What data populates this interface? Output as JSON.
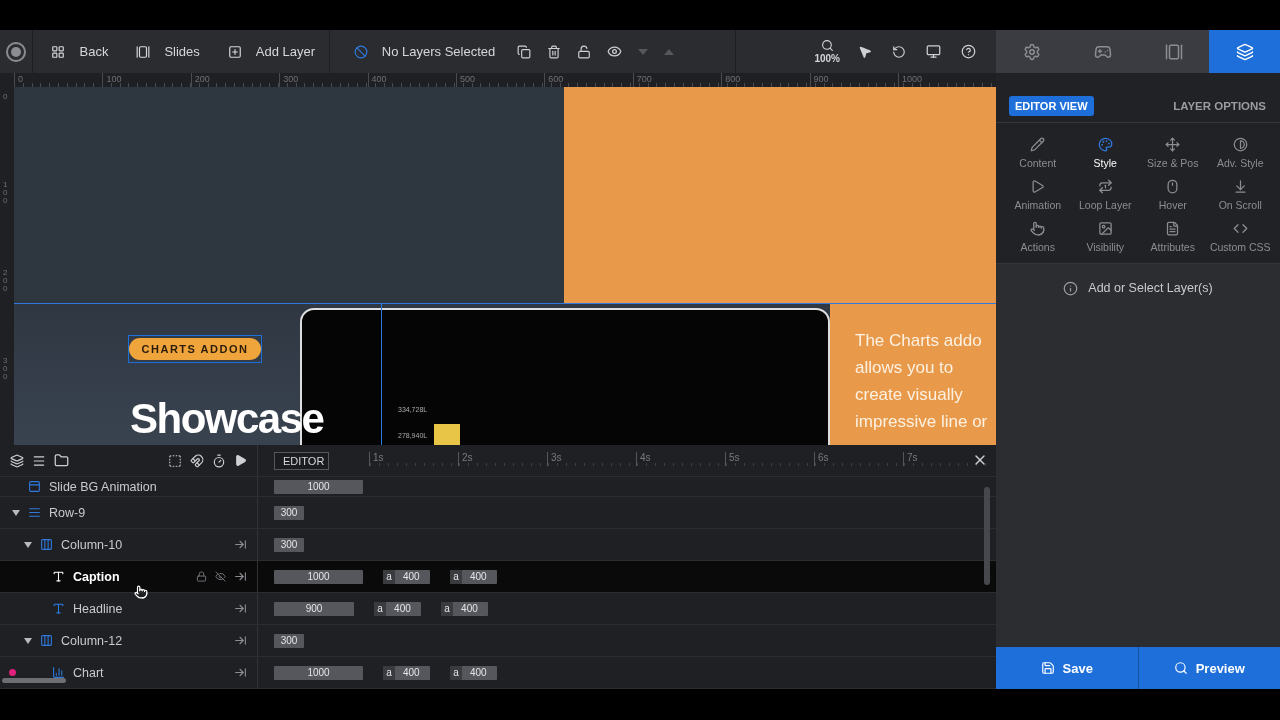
{
  "toolbar": {
    "items": [
      {
        "kind": "back",
        "label": "Back"
      },
      {
        "kind": "slides",
        "label": "Slides"
      },
      {
        "kind": "add",
        "label": "Add Layer"
      }
    ],
    "selection": "No Layers Selected",
    "zoom": "100%"
  },
  "ruler": {
    "marks": [
      "0",
      "100",
      "200",
      "300",
      "400",
      "500",
      "600",
      "700",
      "800",
      "900",
      "1000"
    ],
    "side_marks": [
      "0",
      "100",
      "200",
      "300"
    ]
  },
  "slide": {
    "badge": "CHARTS ADDON",
    "headline": "Showcase",
    "chart_labels": [
      "334,728L",
      "278,940L"
    ],
    "paragraph_lines": [
      "The Charts addo",
      "allows you to",
      "create visually",
      "impressive line or"
    ]
  },
  "timeline": {
    "mode": "EDITOR",
    "ticks": [
      "1s",
      "2s",
      "3s",
      "4s",
      "5s",
      "6s",
      "7s"
    ],
    "layers": [
      {
        "name": "Slide BG Animation",
        "kind": "background",
        "timing": [
          {
            "kind": "duration",
            "value": "1000"
          }
        ]
      },
      {
        "name": "Row-9",
        "kind": "row",
        "expanded": true,
        "timing": [
          {
            "kind": "duration",
            "value": "300"
          }
        ],
        "children": [
          {
            "name": "Column-10",
            "kind": "column",
            "expanded": true,
            "timing": [
              {
                "kind": "duration",
                "value": "300"
              }
            ],
            "children": [
              {
                "name": "Caption",
                "kind": "text",
                "selected": true,
                "timing": [
                  {
                    "kind": "duration",
                    "value": "1000"
                  },
                  {
                    "kind": "frame",
                    "prefix": "a",
                    "value": "400"
                  },
                  {
                    "kind": "frame",
                    "prefix": "a",
                    "value": "400"
                  }
                ]
              },
              {
                "name": "Headline",
                "kind": "text",
                "selected": false,
                "timing": [
                  {
                    "kind": "duration",
                    "value": "900"
                  },
                  {
                    "kind": "frame",
                    "prefix": "a",
                    "value": "400"
                  },
                  {
                    "kind": "frame",
                    "prefix": "a",
                    "value": "400"
                  }
                ]
              }
            ]
          },
          {
            "name": "Column-12",
            "kind": "column",
            "expanded": true,
            "timing": [
              {
                "kind": "duration",
                "value": "300"
              }
            ],
            "children": [
              {
                "name": "Chart",
                "kind": "chart",
                "selected": false,
                "marker": true,
                "timing": [
                  {
                    "kind": "duration",
                    "value": "1000"
                  },
                  {
                    "kind": "frame",
                    "prefix": "a",
                    "value": "400"
                  },
                  {
                    "kind": "frame",
                    "prefix": "a",
                    "value": "400"
                  }
                ]
              }
            ]
          }
        ]
      }
    ]
  },
  "panel": {
    "tabs": [
      {
        "kind": "settings",
        "selected": false
      },
      {
        "kind": "navigation",
        "selected": false
      },
      {
        "kind": "slides",
        "selected": false
      },
      {
        "kind": "layers",
        "selected": true
      }
    ],
    "view": "EDITOR VIEW",
    "options_title": "LAYER OPTIONS",
    "options": [
      {
        "kind": "content",
        "label": "Content",
        "selected": false
      },
      {
        "kind": "style",
        "label": "Style",
        "selected": true
      },
      {
        "kind": "size",
        "label": "Size & Pos",
        "selected": false
      },
      {
        "kind": "adv",
        "label": "Adv. Style",
        "selected": false
      },
      {
        "kind": "animation",
        "label": "Animation",
        "selected": false
      },
      {
        "kind": "loop",
        "label": "Loop Layer",
        "selected": false
      },
      {
        "kind": "hover",
        "label": "Hover",
        "selected": false
      },
      {
        "kind": "scroll",
        "label": "On Scroll",
        "selected": false
      },
      {
        "kind": "actions",
        "label": "Actions",
        "selected": false
      },
      {
        "kind": "visibility",
        "label": "Visibility",
        "selected": false
      },
      {
        "kind": "attributes",
        "label": "Attributes",
        "selected": false
      },
      {
        "kind": "css",
        "label": "Custom CSS",
        "selected": false
      }
    ],
    "hint": "Add or Select Layer(s)",
    "save": "Save",
    "preview": "Preview"
  }
}
